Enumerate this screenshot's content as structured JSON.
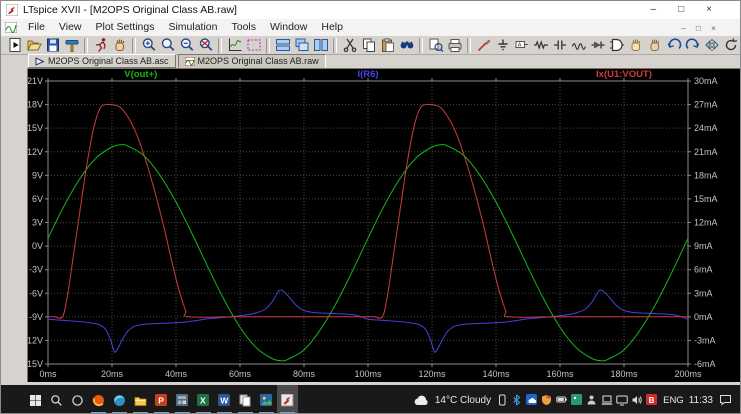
{
  "window": {
    "title": "LTspice XVII - [M2OPS Original Class AB.raw]",
    "controls": [
      "–",
      "□",
      "×"
    ]
  },
  "menu": {
    "items": [
      "File",
      "View",
      "Plot Settings",
      "Simulation",
      "Tools",
      "Window",
      "Help"
    ],
    "mdi_controls": [
      "–",
      "□",
      "×"
    ]
  },
  "toolbar": {
    "items": [
      "run-doc",
      "open",
      "save",
      "control-panel",
      "|",
      "run-man",
      "halt",
      "|",
      "zoom-in",
      "zoom-back",
      "zoom-out",
      "zoom-full",
      "|",
      "autorange",
      "zoom-box",
      "|",
      "tile-horizontal",
      "cascade",
      "tile-vertical",
      "|",
      "cut",
      "copy",
      "paste",
      "find",
      "|",
      "print-preview",
      "print",
      "|",
      "wire",
      "ground",
      "net-label",
      "resistor",
      "capacitor",
      "inductor",
      "diode",
      "component",
      "move-hand",
      "drag-hand",
      "undo",
      "redo",
      "mirror",
      "rotate",
      "text",
      "spice-directive"
    ]
  },
  "tabs": [
    {
      "label": "M2OPS Original Class AB.asc",
      "icon": "schematic-icon",
      "active": false
    },
    {
      "label": "M2OPS Original Class AB.raw",
      "icon": "waveform-icon",
      "active": true
    }
  ],
  "chart_data": {
    "type": "line",
    "title": "",
    "x_unit": "ms",
    "x_range": [
      0,
      200
    ],
    "x_tick_step": 20,
    "x_tick_labels": [
      "0ms",
      "20ms",
      "40ms",
      "60ms",
      "80ms",
      "100ms",
      "120ms",
      "140ms",
      "160ms",
      "180ms",
      "200ms"
    ],
    "y_left": {
      "unit": "V",
      "range": [
        -15,
        21
      ],
      "tick_step": 3,
      "tick_labels": [
        "21V",
        "18V",
        "15V",
        "12V",
        "9V",
        "6V",
        "3V",
        "0V",
        "-3V",
        "-6V",
        "-9V",
        "-12V",
        "-15V"
      ]
    },
    "y_right": {
      "unit": "mA",
      "range": [
        -6,
        30
      ],
      "tick_step": 3,
      "tick_labels": [
        "30mA",
        "27mA",
        "24mA",
        "21mA",
        "18mA",
        "15mA",
        "12mA",
        "9mA",
        "6mA",
        "3mA",
        "0mA",
        "-3mA",
        "-6mA"
      ]
    },
    "grid": "dotted",
    "background": "#000000",
    "grid_color": "#474747",
    "axis_color": "#8c8c8c",
    "label_color": "#c4c4c4",
    "period_ms": 100,
    "repeat": 2,
    "series": [
      {
        "name": "V(out+)",
        "axis": "left",
        "color": "#17b517",
        "legend_x_frac": 0.145,
        "points": [
          [
            0,
            1.0
          ],
          [
            5,
            5.1
          ],
          [
            10,
            8.6
          ],
          [
            15,
            11.2
          ],
          [
            20,
            12.6
          ],
          [
            23,
            12.9
          ],
          [
            25,
            12.7
          ],
          [
            30,
            11.5
          ],
          [
            35,
            9.0
          ],
          [
            40,
            5.6
          ],
          [
            45,
            1.6
          ],
          [
            50,
            -2.7
          ],
          [
            55,
            -6.8
          ],
          [
            60,
            -10.3
          ],
          [
            65,
            -12.9
          ],
          [
            70,
            -14.3
          ],
          [
            73,
            -14.6
          ],
          [
            75,
            -14.4
          ],
          [
            80,
            -13.2
          ],
          [
            85,
            -10.7
          ],
          [
            90,
            -7.3
          ],
          [
            95,
            -3.3
          ],
          [
            100,
            1.0
          ]
        ]
      },
      {
        "name": "I(R6)",
        "axis": "right",
        "color": "#4444e0",
        "legend_x_frac": 0.5,
        "points": [
          [
            0,
            -0.3
          ],
          [
            5,
            -0.45
          ],
          [
            10,
            -0.6
          ],
          [
            13,
            -0.75
          ],
          [
            16,
            -1.0
          ],
          [
            18,
            -1.6
          ],
          [
            19.5,
            -2.9
          ],
          [
            20.5,
            -4.2
          ],
          [
            21,
            -4.5
          ],
          [
            22,
            -3.9
          ],
          [
            23.5,
            -2.7
          ],
          [
            25,
            -1.8
          ],
          [
            27,
            -1.2
          ],
          [
            30,
            -0.95
          ],
          [
            34,
            -0.85
          ],
          [
            38,
            -0.8
          ],
          [
            42,
            -0.7
          ],
          [
            46,
            -0.5
          ],
          [
            50,
            -0.25
          ],
          [
            54,
            -0.1
          ],
          [
            58,
            0.05
          ],
          [
            62,
            0.25
          ],
          [
            65,
            0.5
          ],
          [
            68,
            1.0
          ],
          [
            70,
            1.9
          ],
          [
            71.5,
            2.9
          ],
          [
            72.5,
            3.4
          ],
          [
            74,
            3.1
          ],
          [
            76,
            2.2
          ],
          [
            78,
            1.3
          ],
          [
            80,
            0.8
          ],
          [
            83,
            0.55
          ],
          [
            87,
            0.45
          ],
          [
            91,
            0.4
          ],
          [
            95,
            0.3
          ],
          [
            98,
            0.0
          ],
          [
            100,
            -0.3
          ]
        ]
      },
      {
        "name": "Ix(U1:VOUT)",
        "axis": "right",
        "color": "#d03a3a",
        "legend_x_frac": 0.9,
        "points": [
          [
            0,
            0
          ],
          [
            2,
            0
          ],
          [
            4.5,
            0
          ],
          [
            6,
            2.5
          ],
          [
            8,
            8
          ],
          [
            10,
            13.5
          ],
          [
            12,
            19
          ],
          [
            14,
            23.5
          ],
          [
            16,
            26.3
          ],
          [
            18,
            27
          ],
          [
            22,
            26.8
          ],
          [
            24,
            26
          ],
          [
            26,
            24.7
          ],
          [
            28,
            22.9
          ],
          [
            30,
            20.6
          ],
          [
            33,
            16.5
          ],
          [
            36,
            11.8
          ],
          [
            39,
            6.5
          ],
          [
            41,
            3.3
          ],
          [
            43,
            0.8
          ],
          [
            44,
            0
          ],
          [
            60,
            0
          ],
          [
            80,
            0
          ],
          [
            98,
            0
          ],
          [
            100,
            0
          ]
        ]
      }
    ]
  },
  "taskbar": {
    "start": "start-button",
    "search": "search-button",
    "cortana": "cortana-button",
    "apps": [
      {
        "icon": "firefox",
        "running": true,
        "active": false
      },
      {
        "icon": "edge",
        "running": true,
        "active": false
      },
      {
        "icon": "explorer",
        "running": true,
        "active": false
      },
      {
        "icon": "powerpoint",
        "running": true,
        "active": false
      },
      {
        "icon": "app-window",
        "running": true,
        "active": false
      },
      {
        "icon": "excel",
        "running": true,
        "active": false
      },
      {
        "icon": "word",
        "running": true,
        "active": false
      },
      {
        "icon": "pages",
        "running": true,
        "active": false
      },
      {
        "icon": "photos",
        "running": true,
        "active": false
      },
      {
        "icon": "ltspice",
        "running": true,
        "active": true
      }
    ],
    "tray": {
      "weather": "14°C Cloudy",
      "icons": [
        "phone",
        "bluetooth",
        "onedrive",
        "defender-shield",
        "battery",
        "photos-tray",
        "user",
        "laptop",
        "display",
        "volume",
        "security-red"
      ],
      "language": "ENG",
      "time": "11:33"
    }
  }
}
